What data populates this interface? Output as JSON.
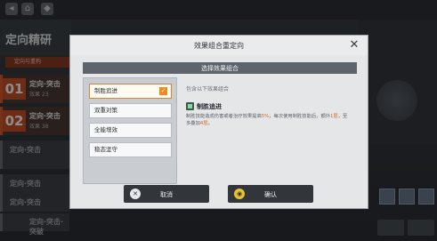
{
  "background": {
    "page_title": "定向精研",
    "subtab": "定向与重构",
    "cards": [
      {
        "num": "01",
        "title": "定向·突击",
        "sub": "效果 23"
      },
      {
        "num": "02",
        "title": "定向·突击",
        "sub": "效果 38"
      },
      {
        "title": "定向·突击"
      },
      {
        "title": "定向·突击"
      },
      {
        "title": "定向·突击"
      },
      {
        "title": "定向·突击·突破"
      }
    ]
  },
  "dialog": {
    "title": "效果组合重定向",
    "subheader": "选择效果组合",
    "options": [
      {
        "label": "制胜追进",
        "selected": true
      },
      {
        "label": "双重对策",
        "selected": false
      },
      {
        "label": "全能增效",
        "selected": false
      },
      {
        "label": "稳态坚守",
        "selected": false
      }
    ],
    "detail": {
      "hint": "包含以下效果组合",
      "name": "制胜追进",
      "desc_part1": "制胜技能造成伤害或者治疗效果提高",
      "desc_hl1": "5%",
      "desc_part2": "，每次使用制胜技能后，额外",
      "desc_hl2": "1层",
      "desc_part3": "，至多叠加",
      "desc_hl3": "4层",
      "desc_part4": "。"
    },
    "cancel_label": "取消",
    "confirm_label": "确认",
    "cancel_icon": "✕",
    "confirm_icon": "◉"
  },
  "colors": {
    "accent_orange": "#f08a1c",
    "highlight": "#e0602a",
    "confirm_yellow": "#e8c32e"
  }
}
